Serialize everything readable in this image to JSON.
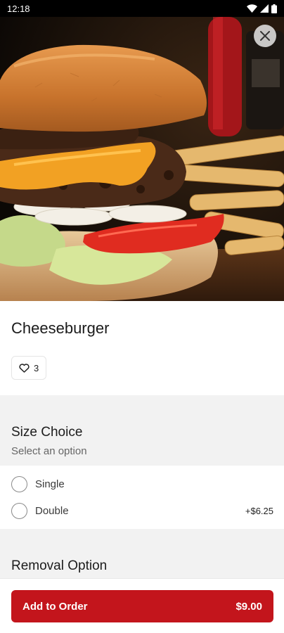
{
  "status_bar": {
    "time": "12:18"
  },
  "hero": {
    "image_alt": "Cheeseburger with fries"
  },
  "item": {
    "title": "Cheeseburger",
    "likes": "3"
  },
  "size_section": {
    "title": "Size Choice",
    "subtitle": "Select an option",
    "options": [
      {
        "label": "Single",
        "price": ""
      },
      {
        "label": "Double",
        "price": "+$6.25"
      }
    ]
  },
  "removal_section": {
    "title": "Removal Option"
  },
  "footer": {
    "add_label": "Add to Order",
    "price": "$9.00"
  },
  "colors": {
    "accent": "#c3151c"
  }
}
